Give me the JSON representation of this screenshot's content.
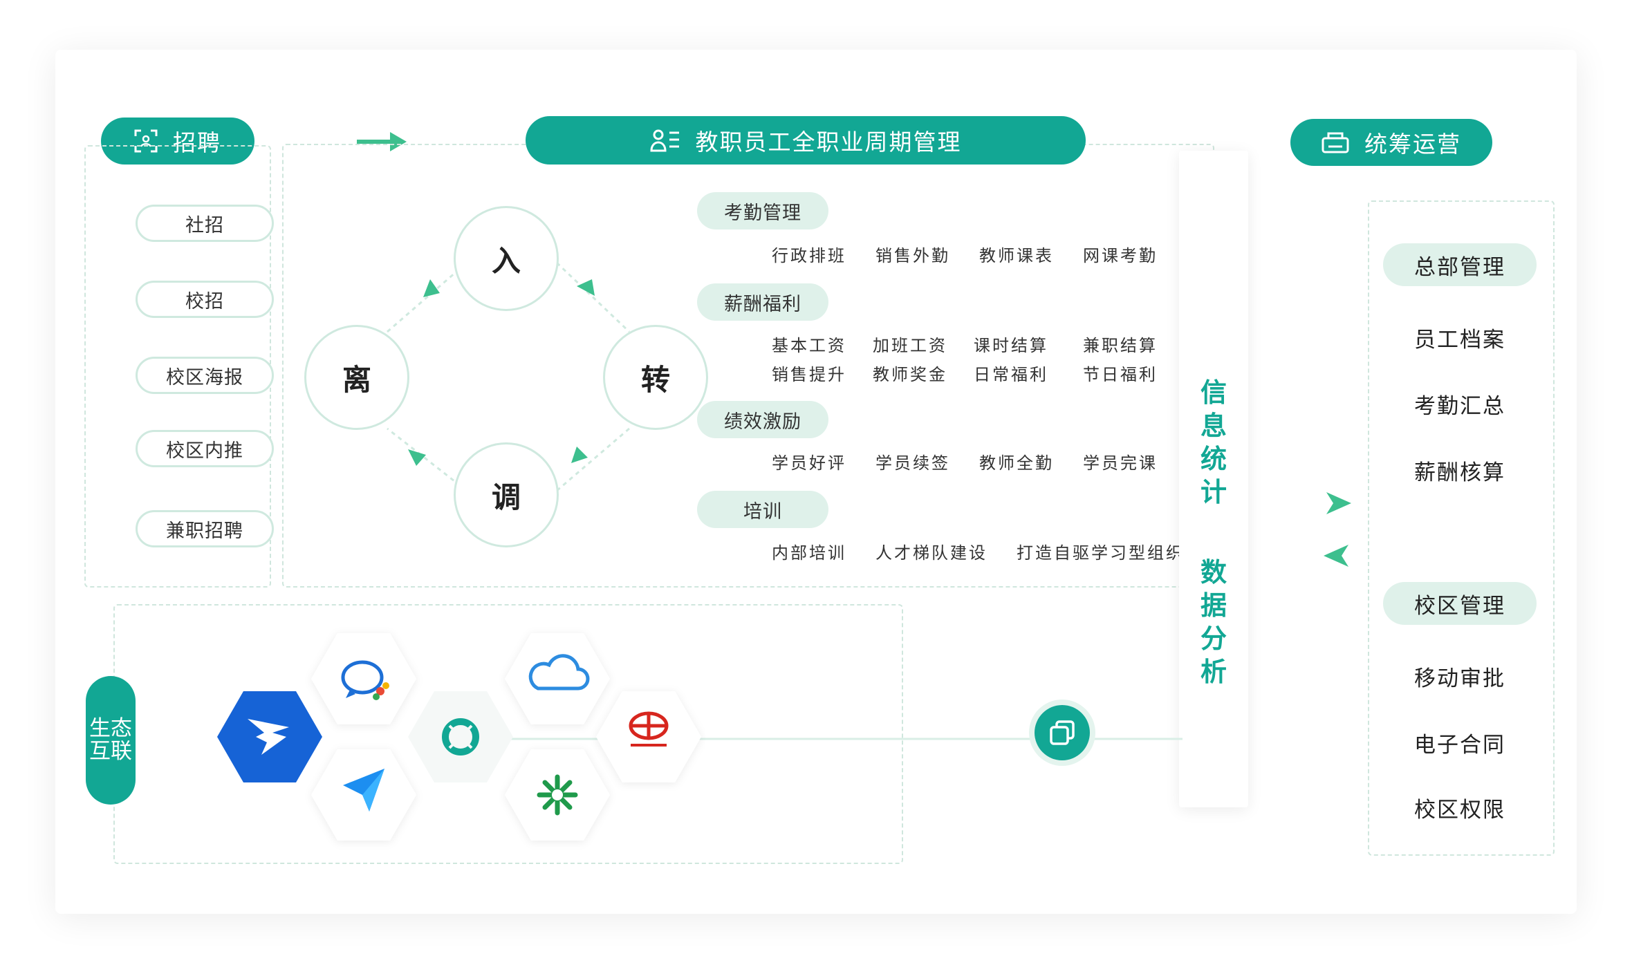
{
  "recruit": {
    "title": "招聘",
    "items": [
      "社招",
      "校招",
      "校区海报",
      "校区内推",
      "兼职招聘"
    ]
  },
  "lifecycle": {
    "title": "教职员工全职业周期管理",
    "cycle": {
      "top": "入",
      "right": "转",
      "bottom": "调",
      "left": "离"
    },
    "categories": [
      {
        "name": "考勤管理",
        "rows": [
          [
            "行政排班",
            "销售外勤",
            "教师课表",
            "网课考勤"
          ]
        ]
      },
      {
        "name": "薪酬福利",
        "rows": [
          [
            "基本工资",
            "加班工资",
            "课时结算",
            "兼职结算"
          ],
          [
            "销售提升",
            "教师奖金",
            "日常福利",
            "节日福利"
          ]
        ]
      },
      {
        "name": "绩效激励",
        "rows": [
          [
            "学员好评",
            "学员续签",
            "教师全勤",
            "学员完课"
          ]
        ]
      },
      {
        "name": "培训",
        "rows": [
          [
            "内部培训",
            "人才梯队建设",
            "打造自驱学习型组织"
          ]
        ]
      }
    ]
  },
  "stats": {
    "line1": [
      "信",
      "息",
      "统",
      "计"
    ],
    "line2": [
      "数",
      "据",
      "分",
      "析"
    ]
  },
  "ops": {
    "title": "统筹运营",
    "hq": {
      "title": "总部管理",
      "items": [
        "员工档案",
        "考勤汇总",
        "薪酬核算"
      ]
    },
    "campus": {
      "title": "校区管理",
      "items": [
        "移动审批",
        "电子合同",
        "校区权限"
      ]
    }
  },
  "eco": {
    "title": "生态互联",
    "title_lines": [
      "生态",
      "互联"
    ],
    "apps": [
      "dingtalk-icon",
      "chat-bubble-icon",
      "paper-plane-icon",
      "cloud-icon",
      "ring-icon",
      "sparkle-icon",
      "bank-logo"
    ]
  },
  "colors": {
    "primary": "#12a794",
    "light": "#dff1ea",
    "arrow": "#3dbf8e",
    "border": "#cfe9df",
    "dingtalk": "#1663d6",
    "bank": "#d7261e"
  }
}
